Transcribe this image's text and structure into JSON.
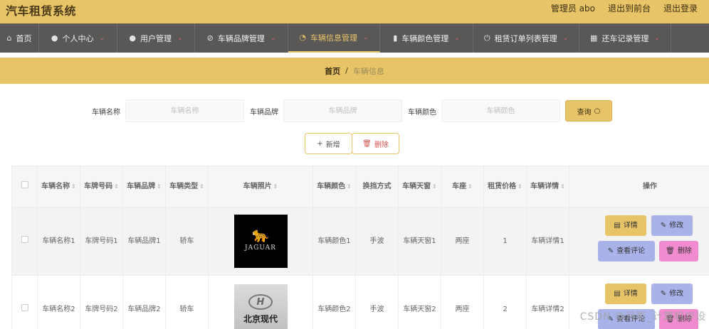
{
  "header": {
    "title": "汽车租赁系统",
    "admin_label": "管理员 abo",
    "to_front_label": "退出到前台",
    "logout_label": "退出登录"
  },
  "nav": [
    {
      "label": "首页",
      "icon": "home-icon",
      "active": false
    },
    {
      "label": "个人中心",
      "icon": "user-icon",
      "active": false
    },
    {
      "label": "用户管理",
      "icon": "user-icon",
      "active": false
    },
    {
      "label": "车辆品牌管理",
      "icon": "tag-icon",
      "active": false
    },
    {
      "label": "车辆信息管理",
      "icon": "gauge-icon",
      "active": true
    },
    {
      "label": "车辆颜色管理",
      "icon": "bar-chart-icon",
      "active": false
    },
    {
      "label": "租赁订单列表管理",
      "icon": "power-icon",
      "active": false
    },
    {
      "label": "还车记录管理",
      "icon": "grid-icon",
      "active": false
    }
  ],
  "breadcrumb": {
    "home": "首页",
    "sep": "/",
    "current": "车辆信息"
  },
  "search": {
    "name_label": "车辆名称",
    "name_placeholder": "车辆名称",
    "brand_label": "车辆品牌",
    "brand_placeholder": "车辆品牌",
    "color_label": "车辆颜色",
    "color_placeholder": "车辆颜色",
    "query_label": "查询"
  },
  "actions": {
    "add_label": "新增",
    "delete_label": "删除"
  },
  "table": {
    "columns": [
      "车辆名称",
      "车牌号码",
      "车辆品牌",
      "车辆类型",
      "车辆照片",
      "车辆颜色",
      "换挡方式",
      "车辆天窗",
      "车座",
      "租赁价格",
      "车辆详情",
      "操作"
    ],
    "rows": [
      {
        "name": "车辆名称1",
        "plate": "车牌号码1",
        "brand": "车辆品牌1",
        "type": "轿车",
        "photo": "JAGUAR",
        "color": "车辆颜色1",
        "gear": "手波",
        "sunroof": "车辆天窗1",
        "seat": "两座",
        "price": "1",
        "detail": "车辆详情1"
      },
      {
        "name": "车辆名称2",
        "plate": "车牌号码2",
        "brand": "车辆品牌2",
        "type": "轿车",
        "photo": "北京现代",
        "color": "车辆颜色2",
        "gear": "手波",
        "sunroof": "车辆天窗2",
        "seat": "两座",
        "price": "2",
        "detail": "车辆详情2"
      }
    ],
    "row_buttons": {
      "detail": "详情",
      "edit": "修改",
      "review": "查看评论",
      "delete": "删除"
    }
  },
  "watermark": "CSDN @月影_计算机毕设",
  "colors": {
    "accent": "#e8c468",
    "nav_bg": "#5a5857",
    "edit": "#a9b3ea",
    "delete": "#f08bd0"
  }
}
